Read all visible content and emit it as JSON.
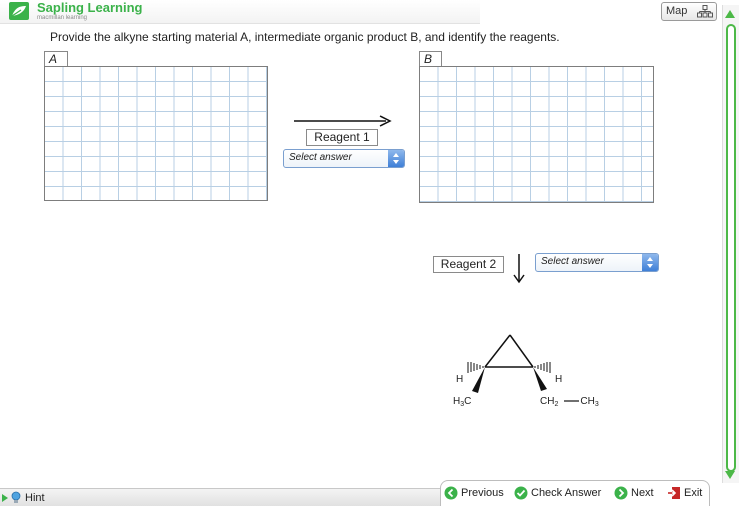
{
  "app": {
    "logo_main": "Sapling Learning",
    "logo_sub": "macmillan learning",
    "brand_color": "#3bb24a"
  },
  "toolbar": {
    "map_label": "Map"
  },
  "question": {
    "text": "Provide the alkyne starting material A, intermediate organic product B, and identify the reagents."
  },
  "boxes": {
    "a_label": "A",
    "b_label": "B"
  },
  "reagent1": {
    "label": "Reagent 1",
    "select_value": "Select answer"
  },
  "reagent2": {
    "label": "Reagent 2",
    "select_value": "Select answer"
  },
  "product": {
    "h_left": "H",
    "h_right": "H",
    "h3c_h": "H",
    "h3c_sub": "3",
    "h3c_c": "C",
    "ch2_c": "CH",
    "ch2_sub": "2",
    "dash": "—",
    "ch3_c": "CH",
    "ch3_sub": "3"
  },
  "footer": {
    "hint_label": "Hint",
    "previous_label": "Previous",
    "check_label": "Check Answer",
    "next_label": "Next",
    "exit_label": "Exit"
  },
  "icons": [
    "leaf-logo-icon",
    "map-icon",
    "bulb-icon",
    "previous-icon",
    "check-icon",
    "next-icon",
    "exit-icon"
  ]
}
